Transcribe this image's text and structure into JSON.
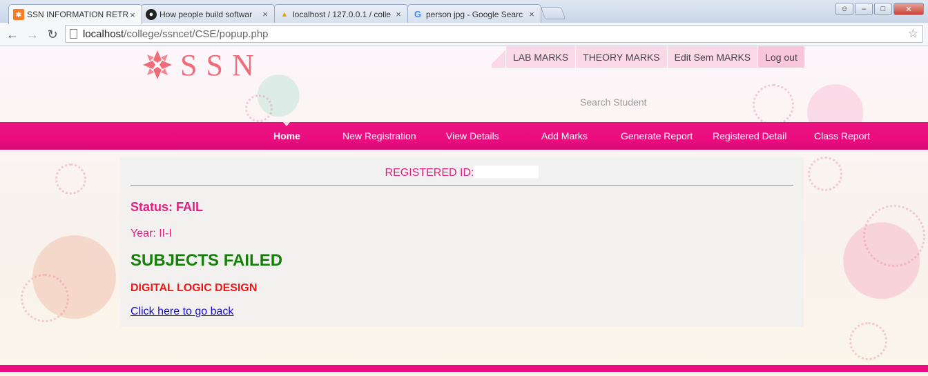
{
  "browser": {
    "tabs": [
      {
        "title": "SSN INFORMATION RETRI",
        "icon": "xampp-icon",
        "active": true
      },
      {
        "title": "How people build softwar",
        "icon": "github-icon",
        "active": false
      },
      {
        "title": "localhost / 127.0.0.1 / colle",
        "icon": "phpmyadmin-icon",
        "active": false
      },
      {
        "title": "person jpg - Google Searc",
        "icon": "google-icon",
        "active": false
      }
    ],
    "tab_close_glyph": "×",
    "url_host": "localhost",
    "url_path": "/college/ssncet/CSE/popup.php",
    "icons": {
      "back": "back-arrow-icon",
      "forward": "forward-arrow-icon",
      "reload": "reload-icon",
      "star": "bookmark-star-icon"
    }
  },
  "header": {
    "logo_text": "SSN",
    "top_links": [
      "LAB MARKS",
      "THEORY MARKS",
      "Edit Sem MARKS",
      "Log out"
    ],
    "search_label": "Search Student"
  },
  "nav": {
    "items": [
      "Home",
      "New Registration",
      "View Details",
      "Add Marks",
      "Generate Report",
      "Registered Detail",
      "Class Report"
    ],
    "active": "Home"
  },
  "result": {
    "registered_id_label": "REGISTERED ID:",
    "registered_id_value": "",
    "status": "Status: FAIL",
    "year": "Year: II-I",
    "failed_heading": "SUBJECTS FAILED",
    "subjects": [
      "DIGITAL LOGIC DESIGN"
    ],
    "back_link": "Click here to go back"
  },
  "colors": {
    "accent_pink": "#ec0d80",
    "text_pink": "#e0217f",
    "fail_heading_green": "#148007",
    "subject_red": "#f01616",
    "link_blue": "#1a0dcc",
    "logo_coral": "#ef6d7a"
  }
}
